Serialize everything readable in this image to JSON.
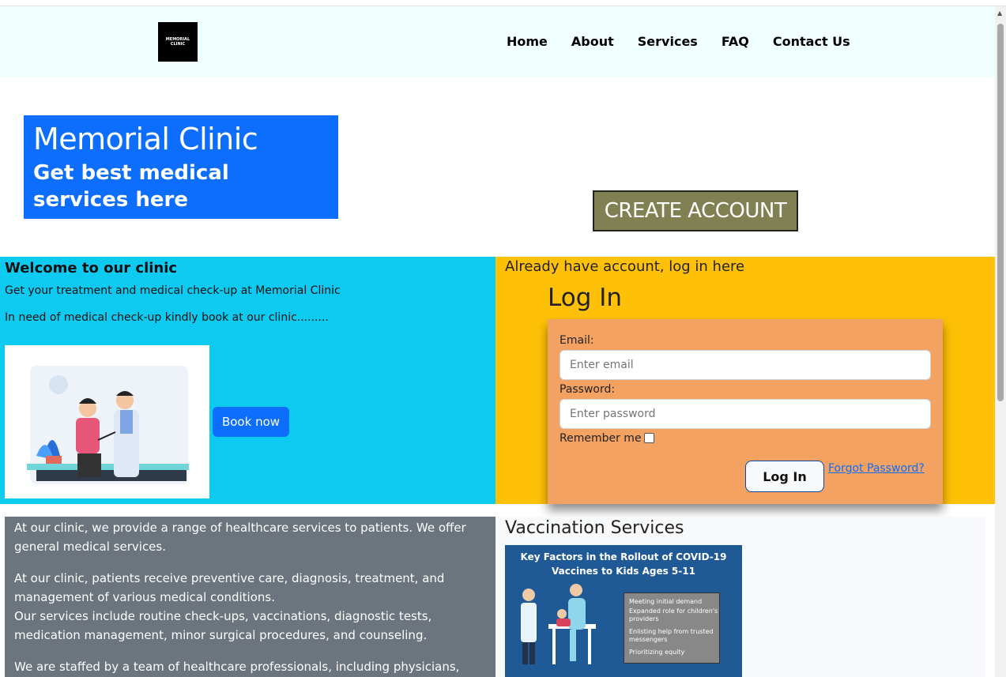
{
  "nav": {
    "logo_text": "MEMORIAL CLINIC",
    "links": [
      "Home",
      "About",
      "Services",
      "FAQ",
      "Contact Us"
    ]
  },
  "hero": {
    "title": "Memorial Clinic",
    "subtitle": "Get best medical services here"
  },
  "create_account": "CREATE ACCOUNT",
  "welcome": {
    "title": "Welcome to our clinic",
    "line1": "Get your treatment and medical check-up at Memorial Clinic",
    "line2": "In need of medical check-up kindly book at our clinic.........",
    "book_button": "Book now"
  },
  "login": {
    "heading": "Already have account, log in here",
    "title": "Log In",
    "email_label": "Email:",
    "email_placeholder": "Enter email",
    "password_label": "Password:",
    "password_placeholder": "Enter password",
    "remember_label": "Remember me",
    "submit": "Log In",
    "forgot": "Forgot Password?"
  },
  "services": {
    "p1": "At our clinic, we provide a range of healthcare services to patients. We offer general medical services.",
    "p2": "At our clinic, patients receive preventive care, diagnosis, treatment, and management of various medical conditions.",
    "p3": "Our services include routine check-ups, vaccinations, diagnostic tests, medication management, minor surgical procedures, and counseling.",
    "p4": "We are staffed by a team of healthcare professionals, including physicians, nurses,"
  },
  "vaccination": {
    "title": "Vaccination Services",
    "image_title": "Key Factors in the Rollout of COVID-19 Vaccines to Kids Ages 5-11",
    "items": [
      "Meeting initial demand",
      "Expanded role for children's providers",
      "Enlisting help from trusted messengers",
      "Prioritizing equity"
    ]
  },
  "colors": {
    "navbar": "#f0ffff",
    "hero": "#0d6efd",
    "create": "#808052",
    "welcome": "#0dcaf0",
    "login_area": "#ffc107",
    "login_card": "#f4a261",
    "services": "#6c757d"
  }
}
